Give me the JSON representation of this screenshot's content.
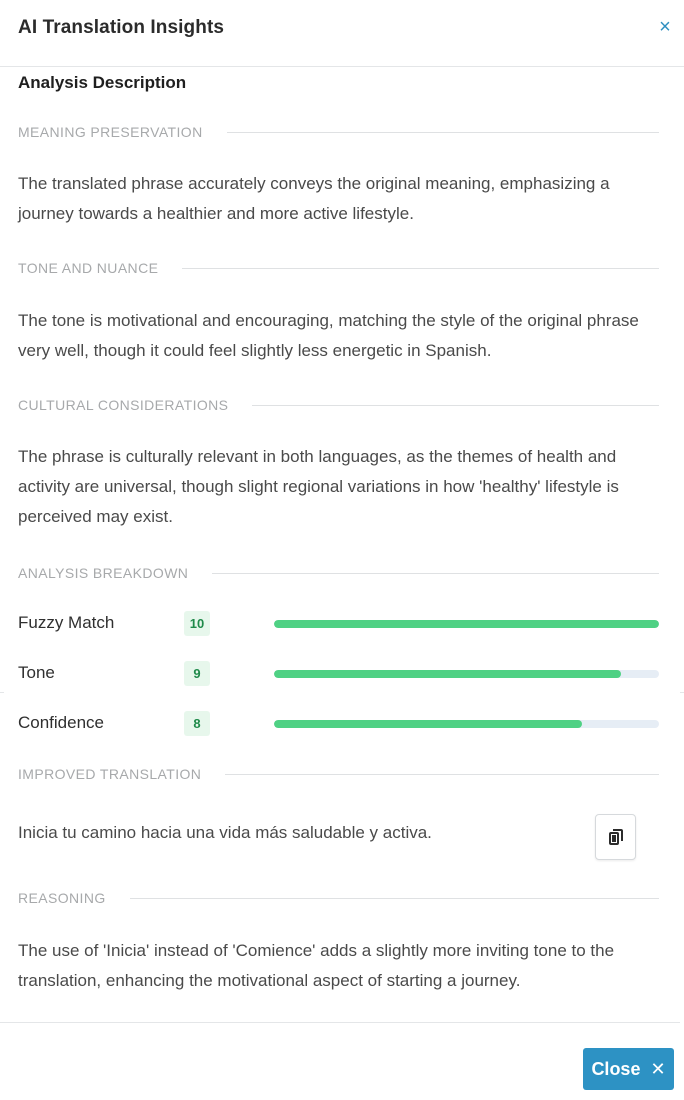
{
  "header": {
    "title": "AI Translation Insights",
    "close_icon": "×"
  },
  "subtitle": "Analysis Description",
  "sections": {
    "meaning": {
      "heading": "MEANING PRESERVATION",
      "text": "The translated phrase accurately conveys the original meaning, emphasizing a journey towards a healthier and more active lifestyle."
    },
    "tone": {
      "heading": "TONE AND NUANCE",
      "text": "The tone is motivational and encouraging, matching the style of the original phrase very well, though it could feel slightly less energetic in Spanish."
    },
    "cultural": {
      "heading": "CULTURAL CONSIDERATIONS",
      "text": "The phrase is culturally relevant in both languages, as the themes of health and activity are universal, though slight regional variations in how 'healthy' lifestyle is perceived may exist."
    },
    "breakdown": {
      "heading": "ANALYSIS BREAKDOWN"
    },
    "improved": {
      "heading": "IMPROVED TRANSLATION",
      "text": "Inicia tu camino hacia una vida más saludable y activa."
    },
    "reasoning": {
      "heading": "REASONING",
      "text": "The use of 'Inicia' instead of 'Comience' adds a slightly more inviting tone to the translation, enhancing the motivational aspect of starting a journey."
    }
  },
  "metrics": [
    {
      "name": "Fuzzy Match",
      "score": "10",
      "fraction": 1.0
    },
    {
      "name": "Tone",
      "score": "9",
      "fraction": 0.9
    },
    {
      "name": "Confidence",
      "score": "8",
      "fraction": 0.8
    }
  ],
  "copy_icon": "copy-icon",
  "footer": {
    "close_label": "Close",
    "close_x": "✕"
  },
  "colors": {
    "accent": "#2d92c4",
    "bar_fill": "#4fd184",
    "bar_track": "#e6edf5",
    "badge_bg": "#e7f7ec",
    "badge_text": "#1f8a4a"
  }
}
